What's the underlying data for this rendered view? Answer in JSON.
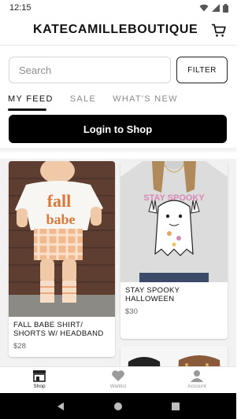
{
  "status_bar": {
    "time": "12:15"
  },
  "header": {
    "brand": "KATECAMILLEBOUTIQUE"
  },
  "search": {
    "placeholder": "Search",
    "filter_label": "FILTER"
  },
  "tabs": [
    {
      "label": "MY FEED",
      "active": true
    },
    {
      "label": "SALE",
      "active": false
    },
    {
      "label": "WHAT'S NEW",
      "active": false
    }
  ],
  "login": {
    "label": "Login to Shop"
  },
  "products": [
    {
      "title": "FALL BABE SHIRT/ SHORTS W/ HEADBAND",
      "price": "$28",
      "graphic_text": "fall babe"
    },
    {
      "title": "STAY SPOOKY HALLOWEEN",
      "price": "$30",
      "graphic_text": "STAY SPOOKY"
    }
  ],
  "bottom_nav": [
    {
      "label": "Shop",
      "icon": "store-icon",
      "active": true
    },
    {
      "label": "Waitlist",
      "icon": "heart-icon",
      "active": false
    },
    {
      "label": "Account",
      "icon": "person-icon",
      "active": false
    }
  ],
  "colors": {
    "accent": "#000000",
    "graphic_orange": "#d9783a"
  }
}
